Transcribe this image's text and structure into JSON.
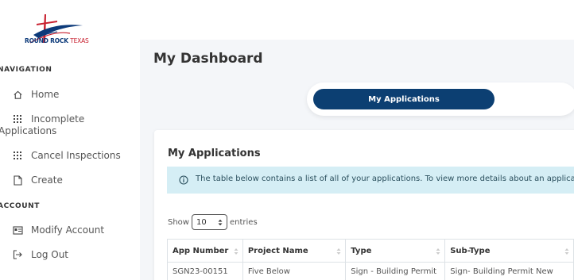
{
  "logo": {
    "text_main": "ROUND ROCK",
    "text_accent": "TEXAS"
  },
  "nav": {
    "section1": "NAVIGATION",
    "items": [
      {
        "label": "Home",
        "icon": "home-icon"
      },
      {
        "label_line1": "Incomplete",
        "label_line2": "Applications",
        "icon": "grid-icon"
      },
      {
        "label": "Cancel Inspections",
        "icon": "grid-icon"
      },
      {
        "label": "Create",
        "icon": "file-icon"
      }
    ],
    "section2": "ACCOUNT",
    "account_items": [
      {
        "label": "Modify Account",
        "icon": "id-card-icon"
      },
      {
        "label": "Log Out",
        "icon": "sign-out-icon"
      }
    ]
  },
  "page": {
    "title": "My Dashboard"
  },
  "tabs": {
    "active": "My Applications"
  },
  "card": {
    "title": "My Applications",
    "alert": "The table below contains a list of all of your applications. To view more details about an application",
    "show_label": "Show",
    "entries_value": "10",
    "entries_label": "entries"
  },
  "table": {
    "headers": [
      "App Number",
      "Project Name",
      "Type",
      "Sub-Type"
    ],
    "rows": [
      [
        "SGN23-00151",
        "Five Below",
        "Sign - Building Permit",
        "Sign- Building Permit New"
      ]
    ]
  },
  "colors": {
    "primary": "#0c3f72",
    "alert_bg": "#d5eef5",
    "background": "#f4f6f9"
  }
}
